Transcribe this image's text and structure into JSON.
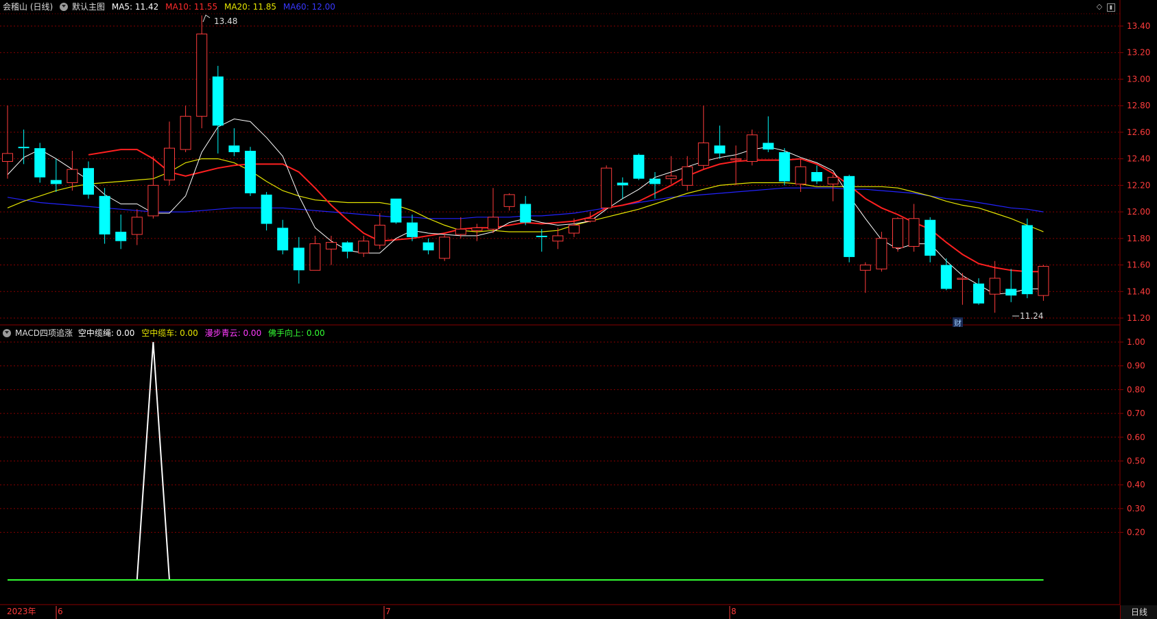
{
  "top_header": {
    "stock": "会稽山 (日线)",
    "template": "默认主图",
    "ma5": "MA5: 11.42",
    "ma10": "MA10: 11.55",
    "ma20": "MA20: 11.85",
    "ma60": "MA60: 12.00"
  },
  "bottom_header": {
    "indicator": "MACD四项追涨",
    "f1": "空中缆绳: 0.00",
    "f2": "空中缆车: 0.00",
    "f3": "漫步青云: 0.00",
    "f4": "佛手向上: 0.00"
  },
  "annotations": {
    "high": "13.48",
    "low": "11.24",
    "cai": "财"
  },
  "x_axis": {
    "year": "2023年",
    "m6": "6",
    "m7": "7",
    "m8": "8"
  },
  "period_button": "日线",
  "colors": {
    "up": "#ff3c3c",
    "down": "#00ffff",
    "ma5": "#ffffff",
    "ma10": "#ff2020",
    "ma20": "#e6e600",
    "ma60": "#2323ff",
    "grid": "#8a0000"
  },
  "chart_data": [
    {
      "type": "candlestick",
      "ylim": [
        11.15,
        13.48
      ],
      "y_ticks": [
        "13.40",
        "13.20",
        "13.00",
        "12.80",
        "12.60",
        "12.40",
        "12.20",
        "12.00",
        "11.80",
        "11.60",
        "11.40",
        "11.20"
      ],
      "candles": [
        [
          12.38,
          12.44,
          12.8,
          12.25
        ],
        [
          12.49,
          12.48,
          12.62,
          12.36
        ],
        [
          12.48,
          12.26,
          12.52,
          12.22
        ],
        [
          12.24,
          12.21,
          12.4,
          12.15
        ],
        [
          12.22,
          12.32,
          12.46,
          12.16
        ],
        [
          12.33,
          12.13,
          12.38,
          12.1
        ],
        [
          12.12,
          11.83,
          12.18,
          11.76
        ],
        [
          11.85,
          11.78,
          11.98,
          11.72
        ],
        [
          11.83,
          11.96,
          12.02,
          11.75
        ],
        [
          11.97,
          12.2,
          12.42,
          11.95
        ],
        [
          12.24,
          12.48,
          12.68,
          12.2
        ],
        [
          12.47,
          12.72,
          12.8,
          12.45
        ],
        [
          12.72,
          13.34,
          13.48,
          12.63
        ],
        [
          13.02,
          12.65,
          13.1,
          12.44
        ],
        [
          12.5,
          12.45,
          12.63,
          12.42
        ],
        [
          12.46,
          12.14,
          12.49,
          12.12
        ],
        [
          12.13,
          11.91,
          12.15,
          11.86
        ],
        [
          11.88,
          11.71,
          11.94,
          11.68
        ],
        [
          11.73,
          11.56,
          11.81,
          11.46
        ],
        [
          11.56,
          11.76,
          11.82,
          11.56
        ],
        [
          11.72,
          11.77,
          11.82,
          11.6
        ],
        [
          11.77,
          11.7,
          11.78,
          11.65
        ],
        [
          11.69,
          11.78,
          11.82,
          11.66
        ],
        [
          11.75,
          11.9,
          11.99,
          11.72
        ],
        [
          12.1,
          11.92,
          12.1,
          11.91
        ],
        [
          11.92,
          11.81,
          11.98,
          11.78
        ],
        [
          11.77,
          11.71,
          11.8,
          11.68
        ],
        [
          11.65,
          11.81,
          11.83,
          11.63
        ],
        [
          11.83,
          11.87,
          11.96,
          11.8
        ],
        [
          11.86,
          11.88,
          11.91,
          11.78
        ],
        [
          11.87,
          11.96,
          12.18,
          11.84
        ],
        [
          12.04,
          12.13,
          12.14,
          12.01
        ],
        [
          12.06,
          11.92,
          12.12,
          11.9
        ],
        [
          11.82,
          11.81,
          11.87,
          11.7
        ],
        [
          11.78,
          11.82,
          11.88,
          11.72
        ],
        [
          11.84,
          11.9,
          11.95,
          11.81
        ],
        [
          11.93,
          11.95,
          12.0,
          11.92
        ],
        [
          12.03,
          12.33,
          12.35,
          12.02
        ],
        [
          12.22,
          12.2,
          12.26,
          12.1
        ],
        [
          12.43,
          12.25,
          12.44,
          12.24
        ],
        [
          12.25,
          12.21,
          12.3,
          12.1
        ],
        [
          12.25,
          12.27,
          12.42,
          12.21
        ],
        [
          12.2,
          12.34,
          12.42,
          12.16
        ],
        [
          12.35,
          12.52,
          12.8,
          12.32
        ],
        [
          12.5,
          12.44,
          12.65,
          12.4
        ],
        [
          12.4,
          12.4,
          12.5,
          12.2
        ],
        [
          12.38,
          12.58,
          12.62,
          12.35
        ],
        [
          12.52,
          12.47,
          12.72,
          12.45
        ],
        [
          12.45,
          12.23,
          12.48,
          12.2
        ],
        [
          12.21,
          12.34,
          12.4,
          12.15
        ],
        [
          12.3,
          12.23,
          12.35,
          12.21
        ],
        [
          12.21,
          12.26,
          12.28,
          12.08
        ],
        [
          12.27,
          11.66,
          12.28,
          11.62
        ],
        [
          11.56,
          11.6,
          11.62,
          11.39
        ],
        [
          11.57,
          11.8,
          11.85,
          11.55
        ],
        [
          11.73,
          11.95,
          11.96,
          11.7
        ],
        [
          11.74,
          11.95,
          12.06,
          11.7
        ],
        [
          11.94,
          11.67,
          11.96,
          11.62
        ],
        [
          11.6,
          11.42,
          11.65,
          11.41
        ],
        [
          11.5,
          11.5,
          11.54,
          11.3
        ],
        [
          11.46,
          11.31,
          11.5,
          11.3
        ],
        [
          11.38,
          11.5,
          11.63,
          11.24
        ],
        [
          11.42,
          11.37,
          11.57,
          11.32
        ],
        [
          11.9,
          11.38,
          11.95,
          11.35
        ],
        [
          11.37,
          11.59,
          11.6,
          11.33
        ]
      ],
      "ma5": [
        12.28,
        12.41,
        12.47,
        12.4,
        12.32,
        12.24,
        12.13,
        12.06,
        12.06,
        11.99,
        11.99,
        12.12,
        12.45,
        12.64,
        12.7,
        12.68,
        12.56,
        12.42,
        12.12,
        11.88,
        11.78,
        11.71,
        11.69,
        11.69,
        11.8,
        11.86,
        11.84,
        11.83,
        11.82,
        11.82,
        11.85,
        11.92,
        11.95,
        11.92,
        11.9,
        11.91,
        11.93,
        12.02,
        12.1,
        12.17,
        12.26,
        12.3,
        12.34,
        12.38,
        12.41,
        12.43,
        12.47,
        12.49,
        12.46,
        12.41,
        12.37,
        12.31,
        12.12,
        11.95,
        11.79,
        11.72,
        11.76,
        11.76,
        11.63,
        11.52,
        11.45,
        11.38,
        11.39,
        11.42,
        11.42
      ],
      "ma10": [
        null,
        null,
        null,
        null,
        null,
        12.43,
        12.45,
        12.47,
        12.47,
        12.4,
        12.3,
        12.27,
        12.3,
        12.33,
        12.35,
        12.36,
        12.36,
        12.36,
        12.3,
        12.18,
        12.05,
        11.94,
        11.84,
        11.78,
        11.79,
        11.8,
        11.82,
        11.84,
        11.87,
        11.88,
        11.88,
        11.9,
        11.92,
        11.91,
        11.92,
        11.93,
        11.96,
        12.03,
        12.05,
        12.08,
        12.14,
        12.2,
        12.27,
        12.32,
        12.36,
        12.38,
        12.39,
        12.39,
        12.39,
        12.4,
        12.36,
        12.29,
        12.2,
        12.1,
        12.03,
        11.98,
        11.92,
        11.87,
        11.77,
        11.68,
        11.61,
        11.58,
        11.56,
        11.55,
        11.55
      ],
      "ma20": [
        12.03,
        12.08,
        12.12,
        12.16,
        12.19,
        12.21,
        12.22,
        12.23,
        12.24,
        12.25,
        12.3,
        12.37,
        12.4,
        12.4,
        12.37,
        12.31,
        12.23,
        12.16,
        12.12,
        12.09,
        12.08,
        12.07,
        12.07,
        12.07,
        12.05,
        12.01,
        11.95,
        11.9,
        11.86,
        11.85,
        11.86,
        11.85,
        11.85,
        11.85,
        11.86,
        11.9,
        11.93,
        11.96,
        11.99,
        12.02,
        12.06,
        12.1,
        12.14,
        12.17,
        12.2,
        12.21,
        12.22,
        12.22,
        12.22,
        12.21,
        12.19,
        12.19,
        12.19,
        12.19,
        12.19,
        12.18,
        12.15,
        12.12,
        12.08,
        12.05,
        12.03,
        11.99,
        11.95,
        11.9,
        11.85
      ],
      "ma60": [
        12.11,
        12.09,
        12.07,
        12.06,
        12.05,
        12.04,
        12.03,
        12.02,
        12.01,
        12.0,
        12.0,
        12.0,
        12.01,
        12.02,
        12.03,
        12.03,
        12.03,
        12.03,
        12.02,
        12.01,
        12.0,
        11.99,
        11.98,
        11.97,
        11.96,
        11.96,
        11.95,
        11.95,
        11.95,
        11.96,
        11.96,
        11.96,
        11.97,
        11.97,
        11.98,
        11.99,
        12.01,
        12.03,
        12.05,
        12.07,
        12.09,
        12.11,
        12.12,
        12.13,
        12.14,
        12.15,
        12.16,
        12.17,
        12.18,
        12.18,
        12.18,
        12.18,
        12.17,
        12.17,
        12.16,
        12.15,
        12.14,
        12.12,
        12.1,
        12.09,
        12.07,
        12.05,
        12.03,
        12.02,
        12.0
      ]
    },
    {
      "type": "line",
      "ylim": [
        0,
        1.03
      ],
      "y_ticks": [
        "1.00",
        "0.90",
        "0.80",
        "0.70",
        "0.60",
        "0.50",
        "0.40",
        "0.30",
        "0.20"
      ],
      "signal": [
        0,
        0,
        0,
        0,
        0,
        0,
        0,
        0,
        0,
        1,
        0,
        0,
        0,
        0,
        0,
        0,
        0,
        0,
        0,
        0,
        0,
        0,
        0,
        0,
        0,
        0,
        0,
        0,
        0,
        0,
        0,
        0,
        0,
        0,
        0,
        0,
        0,
        0,
        0,
        0,
        0,
        0,
        0,
        0,
        0,
        0,
        0,
        0,
        0,
        0,
        0,
        0,
        0,
        0,
        0,
        0,
        0,
        0,
        0,
        0,
        0,
        0,
        0,
        0,
        0
      ]
    }
  ]
}
